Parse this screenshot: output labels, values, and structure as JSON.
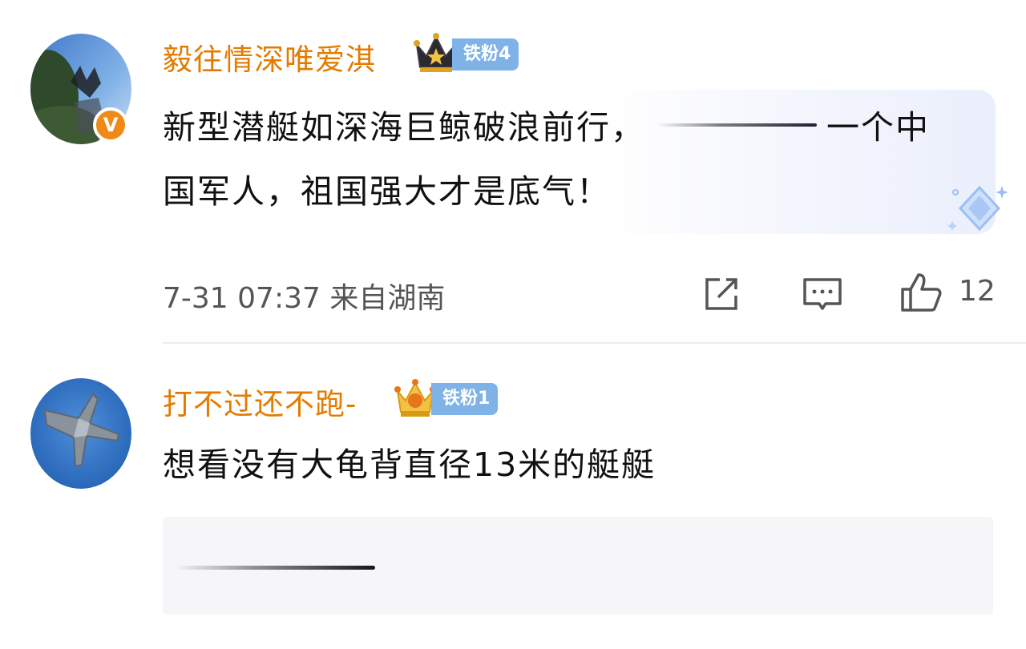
{
  "comments": [
    {
      "username": "毅往情深唯爱淇",
      "fan_badge": "铁粉4",
      "verified_mark": "V",
      "text_line1_before": "新型潜艇如深海巨鲸破浪前行，",
      "text_line1_after": "一个中",
      "text_line2": "国军人，祖国强大才是底气！",
      "timestamp": "7-31 07:37 来自湖南",
      "like_count": "12",
      "avatar_icon": "avatar-photo",
      "badge_icon": "crown-icon"
    },
    {
      "username": "打不过还不跑-",
      "fan_badge": "铁粉1",
      "text": "想看没有大龟背直径13米的艇艇",
      "avatar_icon": "fighter-jet-avatar",
      "badge_icon": "crown-icon"
    }
  ],
  "icons": {
    "share": "share-icon",
    "comment": "comment-icon",
    "like": "thumbs-up-icon",
    "decoration": "diamond-decoration-icon"
  },
  "colors": {
    "username": "#e37b00",
    "fan_badge": "#7fb2e6",
    "verified": "#f08a17",
    "text": "#111111",
    "meta": "#555555"
  }
}
